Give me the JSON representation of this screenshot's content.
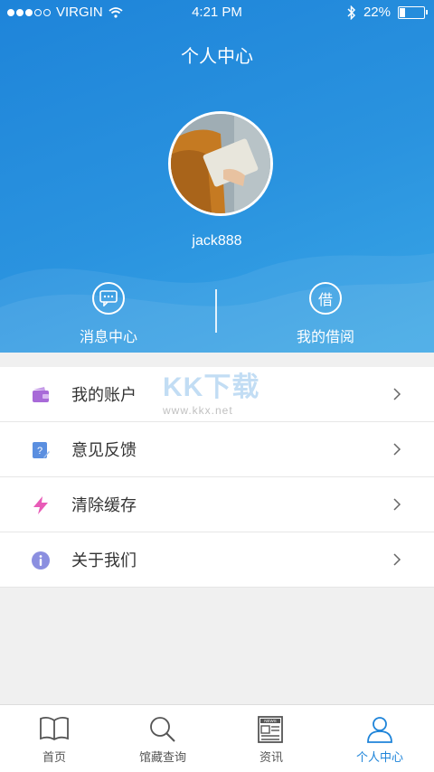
{
  "status_bar": {
    "carrier": "VIRGIN",
    "time": "4:21 PM",
    "battery": "22%"
  },
  "header": {
    "title": "个人中心",
    "username": "jack888"
  },
  "quick_actions": [
    {
      "label": "消息中心",
      "icon": "chat-bubble-icon"
    },
    {
      "label": "我的借阅",
      "icon_text": "借"
    }
  ],
  "menu": {
    "items": [
      {
        "label": "我的账户",
        "icon": "wallet-icon",
        "color": "#a86ad8"
      },
      {
        "label": "意见反馈",
        "icon": "feedback-icon",
        "color": "#5b8fe0"
      },
      {
        "label": "清除缓存",
        "icon": "lightning-icon",
        "color": "#e85bb7"
      },
      {
        "label": "关于我们",
        "icon": "info-icon",
        "color": "#8b8fe0"
      }
    ]
  },
  "watermark": {
    "logo": "KK下载",
    "url": "www.kkx.net"
  },
  "tabbar": {
    "tabs": [
      {
        "label": "首页",
        "icon": "book-icon"
      },
      {
        "label": "馆藏查询",
        "icon": "search-icon"
      },
      {
        "label": "资讯",
        "icon": "newspaper-icon"
      },
      {
        "label": "个人中心",
        "icon": "person-icon",
        "active": true
      }
    ],
    "active_color": "#1e84d9"
  }
}
